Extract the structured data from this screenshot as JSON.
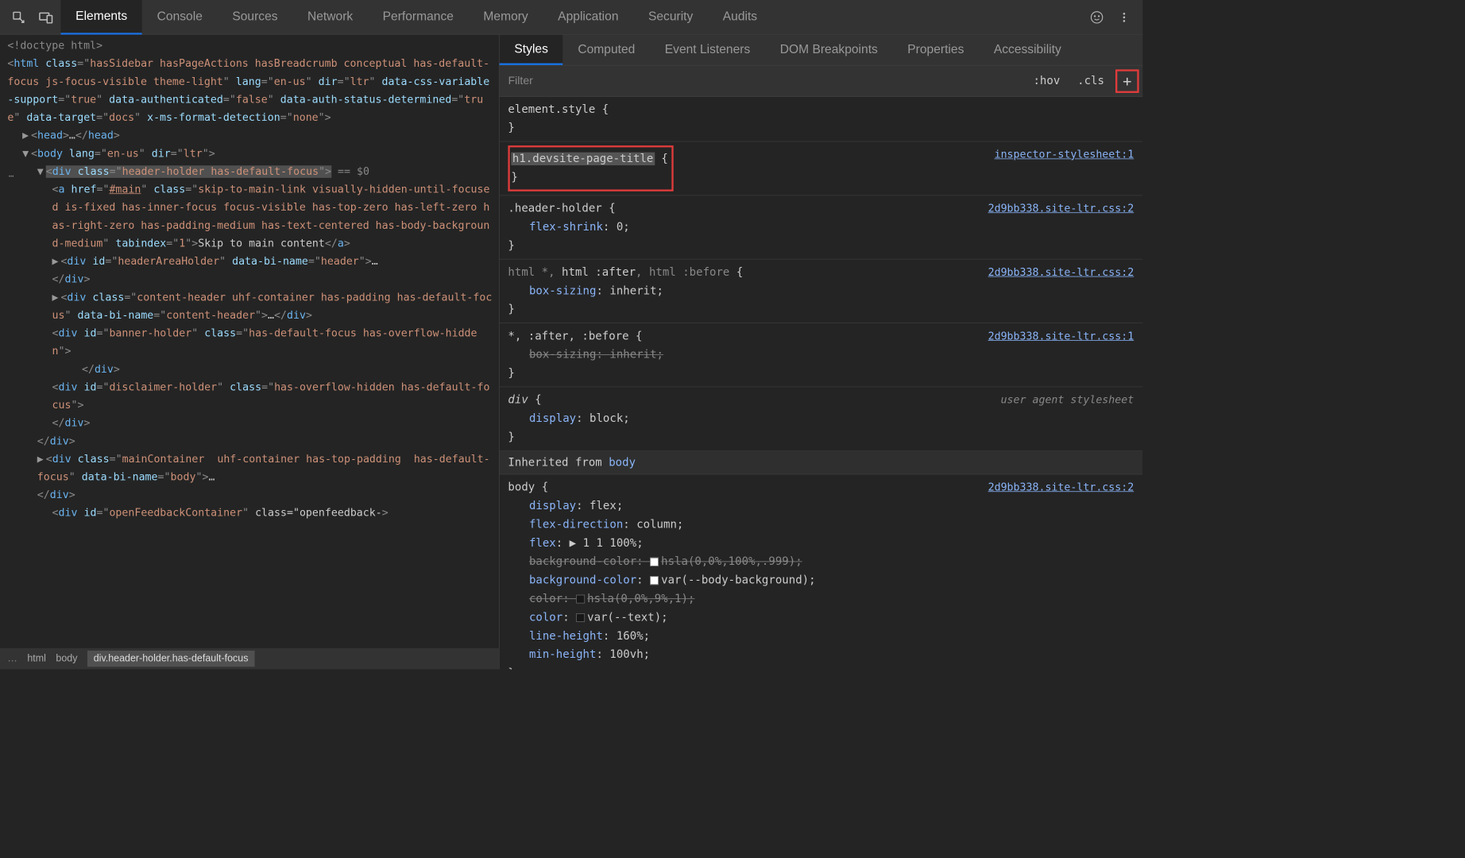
{
  "toolbar": {
    "main_tabs": [
      "Elements",
      "Console",
      "Sources",
      "Network",
      "Performance",
      "Memory",
      "Application",
      "Security",
      "Audits"
    ],
    "active_tab": "Elements"
  },
  "dom": {
    "doctype": "<!doctype html>",
    "html_open": {
      "tag": "html",
      "attrs": "class=\"hasSidebar hasPageActions hasBreadcrumb conceptual has-default-focus js-focus-visible theme-light\" lang=\"en-us\" dir=\"ltr\" data-css-variable-support=\"true\" data-authenticated=\"false\" data-auth-status-determined=\"true\" data-target=\"docs\" x-ms-format-detection=\"none\""
    },
    "head": {
      "tag": "head",
      "ellipsis": "…"
    },
    "body_open": {
      "tag": "body",
      "attrs": "lang=\"en-us\" dir=\"ltr\""
    },
    "sel_div": {
      "tag": "div",
      "attrs": "class=\"header-holder has-default-focus\"",
      "hint": " == $0"
    },
    "a1": {
      "tag": "a",
      "attrs": "href=\"#main\" class=\"skip-to-main-link visually-hidden-until-focused is-fixed has-inner-focus focus-visible has-top-zero has-left-zero has-right-zero has-padding-medium has-text-centered has-body-background-medium\" tabindex=\"1\"",
      "text": "Skip to main content"
    },
    "div_hah": {
      "tag": "div",
      "attrs": "id=\"headerAreaHolder\" data-bi-name=\"header\"",
      "ellipsis": "…"
    },
    "div_ch": {
      "tag": "div",
      "attrs": "class=\"content-header uhf-container has-padding has-default-focus\" data-bi-name=\"content-header\"",
      "ellipsis": "…"
    },
    "div_bh": {
      "tag": "div",
      "attrs": "id=\"banner-holder\" class=\"has-default-focus has-overflow-hidden\""
    },
    "div_dh": {
      "tag": "div",
      "attrs": "id=\"disclaimer-holder\" class=\"has-overflow-hidden has-default-focus\""
    },
    "div_mc": {
      "tag": "div",
      "attrs": "class=\"mainContainer  uhf-container has-top-padding  has-default-focus\" data-bi-name=\"body\"",
      "ellipsis": "…"
    },
    "div_ofc": {
      "tag": "div",
      "attrs": "id=\"openFeedbackContainer\" class=\"openfeedback-"
    }
  },
  "breadcrumb": [
    "html",
    "body",
    "div.header-holder.has-default-focus"
  ],
  "subtabs": [
    "Styles",
    "Computed",
    "Event Listeners",
    "DOM Breakpoints",
    "Properties",
    "Accessibility"
  ],
  "active_subtab": "Styles",
  "filter": {
    "placeholder": "Filter",
    "hov": ":hov",
    "cls": ".cls",
    "plus": "+"
  },
  "styles": {
    "element_style": {
      "sel": "element.style",
      "open": "{",
      "close": "}"
    },
    "new_rule": {
      "sel": "h1.devsite-page-title",
      "open": "{",
      "close": "}",
      "src": "inspector-stylesheet:1"
    },
    "header_holder": {
      "sel": ".header-holder",
      "open": "{",
      "close": "}",
      "src": "2d9bb338.site-ltr.css:2",
      "props": [
        {
          "n": "flex-shrink",
          "v": "0"
        }
      ]
    },
    "html_star": {
      "sel_dim": "html *, ",
      "sel": "html :after",
      "sel_dim2": ", html :before",
      "open": "{",
      "close": "}",
      "src": "2d9bb338.site-ltr.css:2",
      "props": [
        {
          "n": "box-sizing",
          "v": "inherit"
        }
      ]
    },
    "star": {
      "sel": "*, :after, :before",
      "open": "{",
      "close": "}",
      "src": "2d9bb338.site-ltr.css:1",
      "props": [
        {
          "n": "box-sizing",
          "v": "inherit",
          "strike": true
        }
      ]
    },
    "div_ua": {
      "sel": "div",
      "open": "{",
      "close": "}",
      "src": "user agent stylesheet",
      "props": [
        {
          "n": "display",
          "v": "block"
        }
      ]
    },
    "inherited_label": "Inherited from",
    "inherited_from": "body",
    "body_rule": {
      "sel": "body",
      "open": "{",
      "close": "}",
      "src": "2d9bb338.site-ltr.css:2",
      "props": [
        {
          "n": "display",
          "v": "flex"
        },
        {
          "n": "flex-direction",
          "v": "column"
        },
        {
          "n": "flex",
          "v": "▶ 1 1 100%"
        },
        {
          "n": "background-color",
          "v": "hsla(0,0%,100%,.999)",
          "strike": true,
          "swatch": "#ffffff"
        },
        {
          "n": "background-color",
          "v": "var(--body-background)",
          "swatch": "#ffffff"
        },
        {
          "n": "color",
          "v": "hsla(0,0%,9%,1)",
          "strike": true,
          "swatch": "#171717"
        },
        {
          "n": "color",
          "v": "var(--text)",
          "swatch": "#171717"
        },
        {
          "n": "line-height",
          "v": "160%"
        },
        {
          "n": "min-height",
          "v": "100vh"
        }
      ]
    }
  }
}
